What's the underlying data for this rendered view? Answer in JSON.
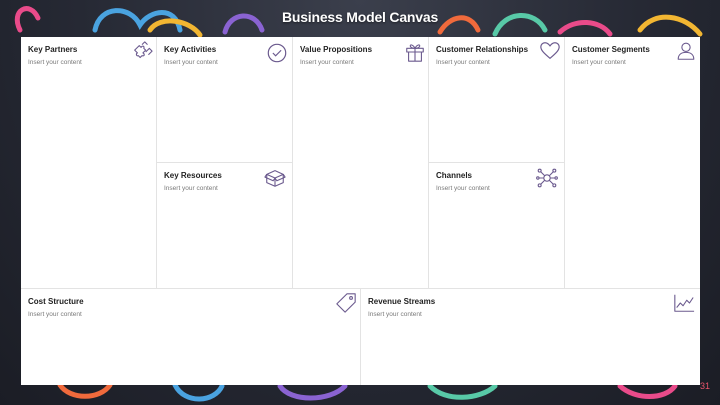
{
  "slide": {
    "title": "Business Model Canvas",
    "page_number": "31"
  },
  "placeholder_text": "Insert your content",
  "blocks": {
    "key_partners": {
      "label": "Key Partners",
      "content": "Insert your content",
      "icon": "puzzle-icon"
    },
    "key_activities": {
      "label": "Key Activities",
      "content": "Insert your content",
      "icon": "checkmark-circle-icon"
    },
    "key_resources": {
      "label": "Key Resources",
      "content": "Insert your content",
      "icon": "box-icon"
    },
    "value_propositions": {
      "label": "Value Propositions",
      "content": "Insert your content",
      "icon": "gift-icon"
    },
    "customer_relationships": {
      "label": "Customer Relationships",
      "content": "Insert your content",
      "icon": "heart-icon"
    },
    "channels": {
      "label": "Channels",
      "content": "Insert your content",
      "icon": "network-icon"
    },
    "customer_segments": {
      "label": "Customer Segments",
      "content": "Insert your content",
      "icon": "user-icon"
    },
    "cost_structure": {
      "label": "Cost Structure",
      "content": "Insert your content",
      "icon": "tag-icon"
    },
    "revenue_streams": {
      "label": "Revenue Streams",
      "content": "Insert your content",
      "icon": "line-chart-icon"
    }
  },
  "colors": {
    "background": "#262934",
    "canvas": "#ffffff",
    "icon_stroke": "#6b5a8e",
    "page_number": "#e8536a",
    "decor": [
      "#e94b8a",
      "#4aa3e0",
      "#f2b632",
      "#58c9a7",
      "#8a63d2",
      "#f06a3c"
    ]
  }
}
